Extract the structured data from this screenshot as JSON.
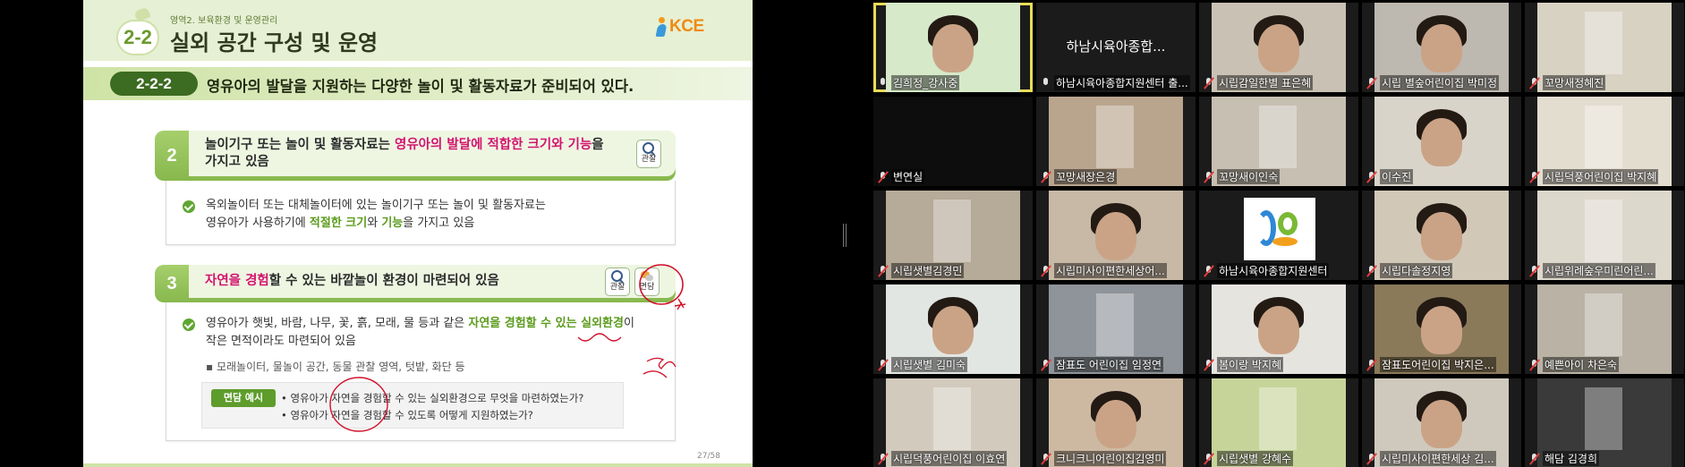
{
  "slide": {
    "area_label": "영역2. 보육환경 및 운영관리",
    "section_number": "2-2",
    "title": "실외 공간 구성 및 운영",
    "logo_text": "KCE",
    "subsection_code": "2-2-2",
    "subsection_text": "영유아의 발달을 지원하는 다양한 놀이 및 활동자료가 준비되어 있다.",
    "item2": {
      "number": "2",
      "line1_pre": "놀이기구 또는 놀이 및 활동자료는 ",
      "line1_hl": "영유아의 발달에 적합한 크기와 기능",
      "line1_post": "을",
      "line2": "가지고 있음",
      "tag_observe": "관찰",
      "check_line1": "옥외놀이터 또는 대체놀이터에 있는 놀이기구 또는 놀이 및 활동자료는",
      "check_line2_pre": "영유아가 사용하기에 ",
      "check_line2_hl1": "적절한 크기",
      "check_line2_mid": "와 ",
      "check_line2_hl2": "기능",
      "check_line2_post": "을 가지고 있음"
    },
    "item3": {
      "number": "3",
      "head_hl": "자연을 경험",
      "head_post": "할 수 있는 바깥놀이 환경이 마련되어 있음",
      "tag_observe": "관찰",
      "tag_interview": "면담",
      "check_line1_pre": "영유아가 햇빛, 바람, 나무, 꽃, 흙, 모래, 물 등과 같은 ",
      "check_line1_hl": "자연을 경험할 수 있는 실외환경",
      "check_line1_post": "이",
      "check_line2": "작은 면적이라도 마련되어 있음",
      "bullet": "모래놀이터, 물놀이 공간, 동물 관찰 영역, 텃밭, 화단 등",
      "example_label": "면담 예시",
      "example_q1": "영유아가 자연을 경험할 수 있는 실외환경으로 무엇을 마련하였는가?",
      "example_q2": "영유아가 자연을 경험할 수 있도록 어떻게 지원하였는가?"
    },
    "page_number": "27/58"
  },
  "gallery": {
    "participants": [
      {
        "name": "김희정_강사중",
        "muted": false,
        "active": true,
        "video": "person",
        "bg": "#d6e9c9"
      },
      {
        "name": "하남시육아종합지원센터 출...",
        "muted": false,
        "active": false,
        "video": "name",
        "center": "하남시육아종합...",
        "bg": "#1b1b1b"
      },
      {
        "name": "시립감일한별 표은혜",
        "muted": true,
        "active": false,
        "video": "person",
        "bg": "#c9c2b4"
      },
      {
        "name": "시립 별숲어린이집 박미정",
        "muted": true,
        "active": false,
        "video": "person",
        "bg": "#bdb8b0"
      },
      {
        "name": "꼬망새정혜진",
        "muted": true,
        "active": false,
        "video": "room",
        "bg": "#d8d2c3"
      },
      {
        "name": "변연실",
        "muted": true,
        "active": false,
        "video": "dark",
        "bg": "#0d0d0d"
      },
      {
        "name": "꼬망새장은경",
        "muted": true,
        "active": false,
        "video": "room",
        "bg": "#b9a58e"
      },
      {
        "name": "꼬망새이인숙",
        "muted": true,
        "active": false,
        "video": "room",
        "bg": "#c7bfb1"
      },
      {
        "name": "이수진",
        "muted": true,
        "active": false,
        "video": "person",
        "bg": "#d9d4c9"
      },
      {
        "name": "시립덕풍어린이집 박지혜",
        "muted": true,
        "active": false,
        "video": "room",
        "bg": "#e3ddd0"
      },
      {
        "name": "시립샛별김경민",
        "muted": true,
        "active": false,
        "video": "room",
        "bg": "#b6aa98"
      },
      {
        "name": "시립미사이편한세상어...",
        "muted": true,
        "active": false,
        "video": "person",
        "bg": "#c8b9a6"
      },
      {
        "name": "하남시육아종합지원센터",
        "muted": true,
        "active": false,
        "video": "logo",
        "bg": "#1b1b1b"
      },
      {
        "name": "시립다솔정지영",
        "muted": true,
        "active": false,
        "video": "person",
        "bg": "#d2c8b8"
      },
      {
        "name": "시립위례숲우미린어린...",
        "muted": true,
        "active": false,
        "video": "room",
        "bg": "#ddd8cc"
      },
      {
        "name": "시립샛별 김미숙",
        "muted": true,
        "active": false,
        "video": "person",
        "bg": "#e2e6e2"
      },
      {
        "name": "잠표도 어린이집 임정연",
        "muted": true,
        "active": false,
        "video": "room",
        "bg": "#8f949a"
      },
      {
        "name": "봄이랑 박지혜",
        "muted": true,
        "active": false,
        "video": "person",
        "bg": "#e6e4df"
      },
      {
        "name": "잠표도어린이집 박지은...",
        "muted": true,
        "active": false,
        "video": "person",
        "bg": "#8a7a5a"
      },
      {
        "name": "예쁜아이 차은숙",
        "muted": true,
        "active": false,
        "video": "room",
        "bg": "#b9b2a5"
      },
      {
        "name": "시립덕풍어린이집 이효연",
        "muted": true,
        "active": false,
        "video": "room",
        "bg": "#d2cbbd"
      },
      {
        "name": "크니크니어린이집김영미",
        "muted": true,
        "active": false,
        "video": "person",
        "bg": "#cdb9a1"
      },
      {
        "name": "시립샛별 강혜수",
        "muted": true,
        "active": false,
        "video": "room",
        "bg": "#c6d49a"
      },
      {
        "name": "시립미사이편한세상 김...",
        "muted": true,
        "active": false,
        "video": "person",
        "bg": "#cfc9bd"
      },
      {
        "name": "해담 김경희",
        "muted": true,
        "active": false,
        "video": "room",
        "bg": "#3a3a3a"
      }
    ]
  }
}
